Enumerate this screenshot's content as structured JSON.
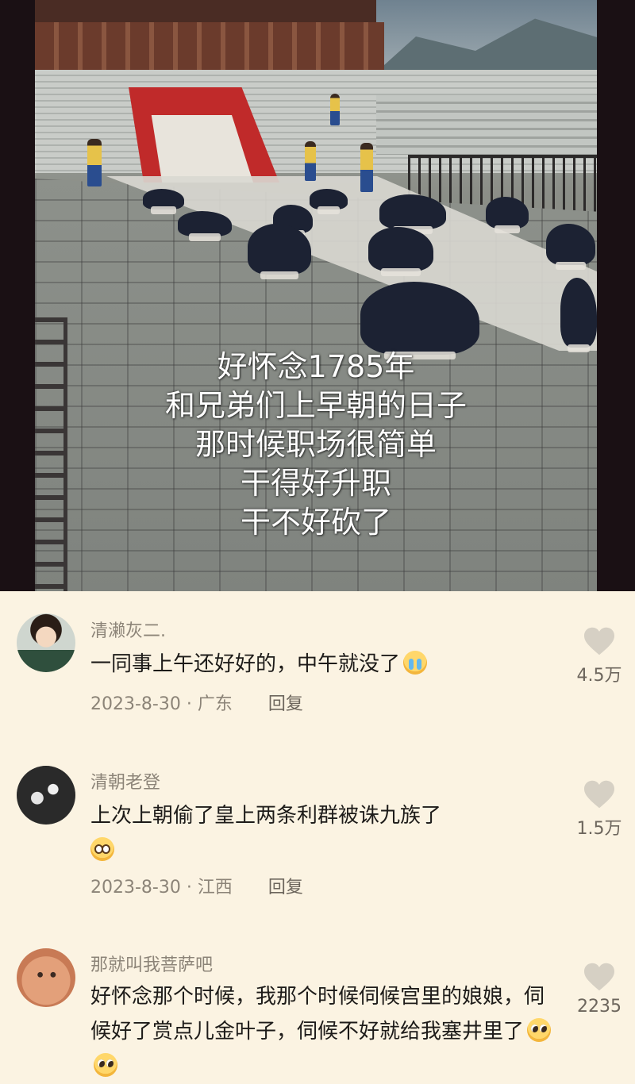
{
  "video": {
    "caption_lines": [
      "好怀念1785年",
      "和兄弟们上早朝的日子",
      "那时候职场很简单",
      "干得好升职",
      "干不好砍了"
    ]
  },
  "comments": [
    {
      "username": "清濑灰二.",
      "text": "一同事上午还好好的，中午就没了",
      "emojis": [
        "crying-face-icon"
      ],
      "date_location": "2023-8-30 · 广东",
      "reply_label": "回复",
      "likes": "4.5万"
    },
    {
      "username": "清朝老登",
      "text": "上次上朝偷了皇上两条利群被诛九族了",
      "emojis": [
        "worried-face-icon"
      ],
      "date_location": "2023-8-30 · 江西",
      "reply_label": "回复",
      "likes": "1.5万"
    },
    {
      "username": "那就叫我菩萨吧",
      "text": "好怀念那个时候，我那个时候伺候宫里的娘娘，伺候好了赏点儿金叶子，伺候不好就给我塞井里了",
      "emojis": [
        "pleading-face-icon",
        "pleading-face-icon"
      ],
      "likes": "2235"
    }
  ],
  "colors": {
    "background": "#fbf3e2",
    "heart": "#d6d0c4",
    "muted_text": "#8c8478"
  }
}
